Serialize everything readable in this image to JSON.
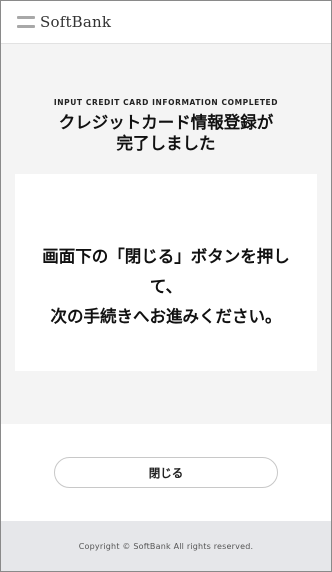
{
  "header": {
    "logo_text": "SoftBank",
    "logo_icon": "softbank-stripes-icon"
  },
  "main": {
    "eyebrow": "INPUT CREDIT CARD INFORMATION COMPLETED",
    "title_line1": "クレジットカード情報登録が",
    "title_line2": "完了しました",
    "message_line1": "画面下の「閉じる」ボタンを押し",
    "message_line2": "て、",
    "message_line3": "次の手続きへお進みください。"
  },
  "actions": {
    "close_label": "閉じる"
  },
  "footer": {
    "copyright": "Copyright © SoftBank All rights reserved."
  }
}
